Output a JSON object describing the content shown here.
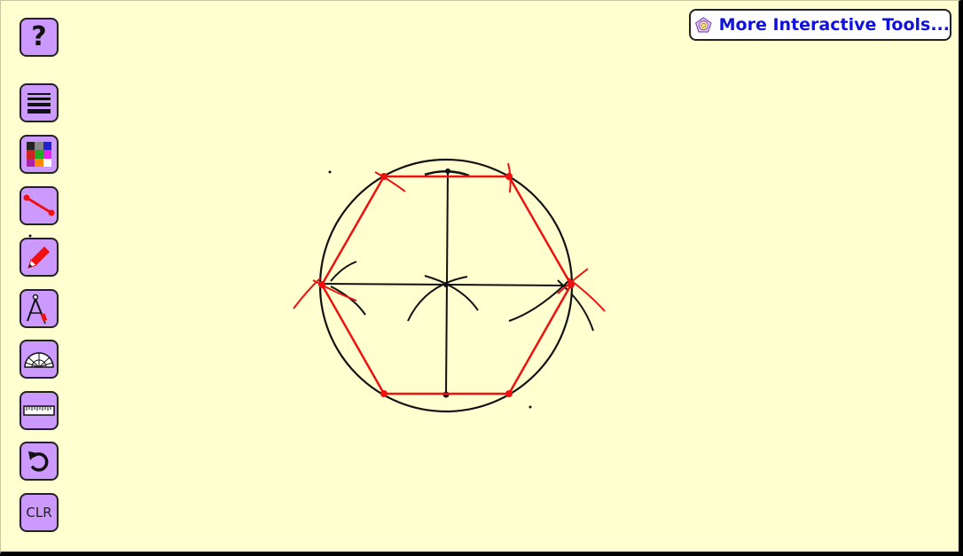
{
  "app": {
    "more_tools_label": "More Interactive Tools..."
  },
  "toolbar": {
    "help_label": "?",
    "clear_label": "CLR"
  },
  "colors": {
    "background": "#ffffd0",
    "tool_button": "#cc99ff",
    "construction_line": "#111111",
    "hexagon": "#ee1111",
    "link_text": "#1111dd"
  }
}
